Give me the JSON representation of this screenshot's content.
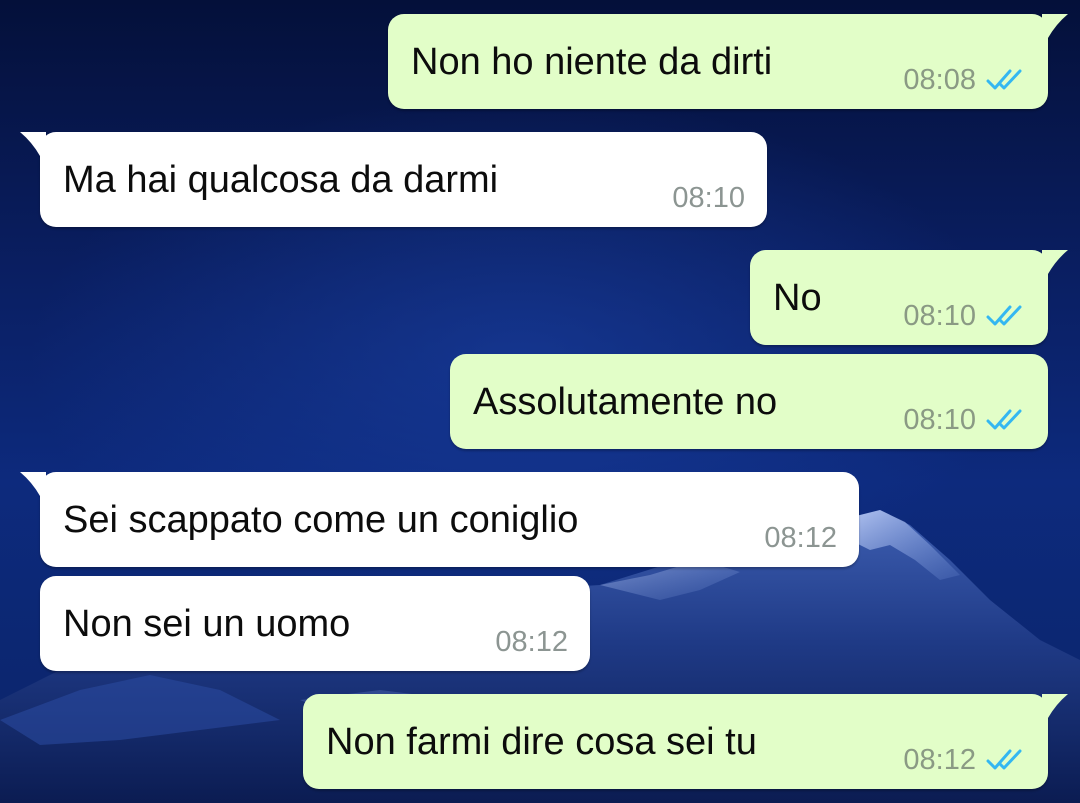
{
  "chat": {
    "messages": [
      {
        "direction": "out",
        "text": "Non ho niente da dirti",
        "time": "08:08",
        "status_icon": "double-check-read-icon"
      },
      {
        "direction": "in",
        "text": "Ma hai qualcosa da darmi",
        "time": "08:10"
      },
      {
        "direction": "out",
        "text": "No",
        "time": "08:10",
        "status_icon": "double-check-read-icon"
      },
      {
        "direction": "out",
        "text": "Assolutamente no",
        "time": "08:10",
        "status_icon": "double-check-read-icon"
      },
      {
        "direction": "in",
        "text": "Sei scappato come un coniglio",
        "time": "08:12"
      },
      {
        "direction": "in",
        "text": "Non sei un uomo",
        "time": "08:12"
      },
      {
        "direction": "out",
        "text": "Non farmi dire cosa sei tu",
        "time": "08:12",
        "status_icon": "double-check-read-icon"
      }
    ]
  },
  "colors": {
    "outgoing_bubble": "#e2fec8",
    "incoming_bubble": "#ffffff",
    "read_ticks": "#34b7f1",
    "wallpaper": "#0a1f63"
  }
}
